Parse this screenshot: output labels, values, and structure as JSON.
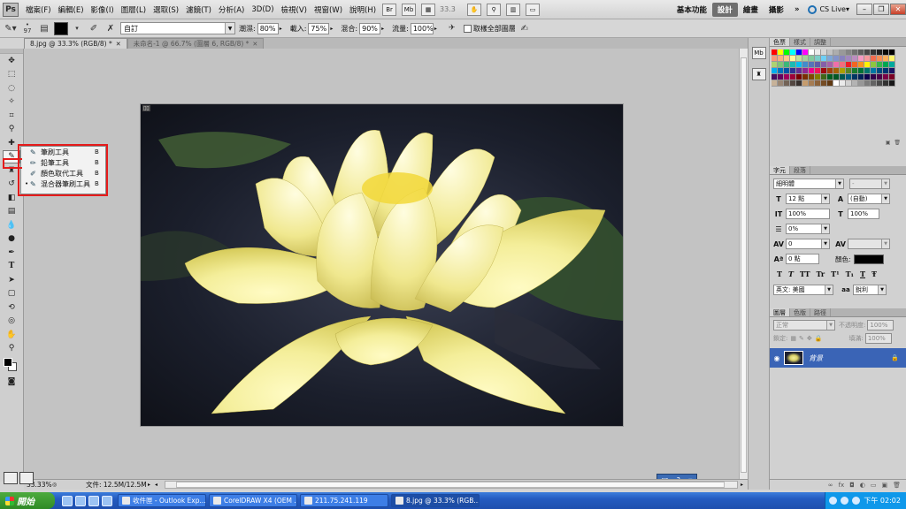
{
  "menubar": {
    "logo": "Ps",
    "menus": [
      "檔案(F)",
      "編輯(E)",
      "影像(I)",
      "圖層(L)",
      "選取(S)",
      "濾鏡(T)",
      "分析(A)",
      "3D(D)",
      "檢視(V)",
      "視窗(W)",
      "說明(H)"
    ],
    "zoom": "33.3",
    "workspaces": [
      "基本功能",
      "設計",
      "繪畫",
      "攝影"
    ],
    "active_workspace": "設計",
    "more": "»",
    "cslive": "CS Live"
  },
  "options": {
    "brush_size": "97",
    "mix_preset": "自訂",
    "wet_label": "潮濕:",
    "wet": "80%",
    "load_label": "載入:",
    "load": "75%",
    "mix_label": "混合:",
    "mix": "90%",
    "flow_label": "流量:",
    "flow": "100%",
    "sample_all": "取樣全部圖層"
  },
  "tabs": [
    {
      "label": "8.jpg @ 33.3% (RGB/8) *",
      "active": true
    },
    {
      "label": "未命名-1 @ 66.7% (圖層 6, RGB/8) *",
      "active": false
    }
  ],
  "flyout": {
    "items": [
      {
        "label": "筆刷工具",
        "key": "B",
        "selected": false
      },
      {
        "label": "鉛筆工具",
        "key": "B",
        "selected": false
      },
      {
        "label": "顏色取代工具",
        "key": "B",
        "selected": false
      },
      {
        "label": "混合器筆刷工具",
        "key": "B",
        "selected": true
      }
    ]
  },
  "status": {
    "zoom": "33.33%",
    "doc": "文件: 12.5M/12.5M"
  },
  "swatches_panel": {
    "tabs": [
      "色票",
      "樣式",
      "調整"
    ],
    "colors": [
      "#ff0000",
      "#ffff00",
      "#00ff00",
      "#00ffff",
      "#0000ff",
      "#ff00ff",
      "#ffffff",
      "#ebebeb",
      "#d6d6d6",
      "#c2c2c2",
      "#adadad",
      "#999999",
      "#858585",
      "#707070",
      "#5c5c5c",
      "#474747",
      "#333333",
      "#1f1f1f",
      "#0a0a0a",
      "#000000",
      "#f7977a",
      "#f9ad81",
      "#fdc68a",
      "#fff79a",
      "#c4df9b",
      "#a2d39c",
      "#82ca9d",
      "#7bcdc8",
      "#6ecff6",
      "#7ea7d8",
      "#8493ca",
      "#8882be",
      "#a187be",
      "#bc8dbf",
      "#f49ac2",
      "#f6989d",
      "#f26c4f",
      "#f68e55",
      "#fbaf5c",
      "#fff467",
      "#acd372",
      "#7cc576",
      "#3bb878",
      "#1abbb4",
      "#00bff3",
      "#438ccb",
      "#5574b9",
      "#605ca8",
      "#855fa8",
      "#a763a8",
      "#f06eaa",
      "#f26d7d",
      "#ed1c24",
      "#f26522",
      "#f7941d",
      "#fff200",
      "#8dc73f",
      "#39b54a",
      "#00a651",
      "#00a99d",
      "#00aeef",
      "#0072bc",
      "#0054a6",
      "#2e3192",
      "#662d91",
      "#92278f",
      "#ec008c",
      "#ed145b",
      "#9e0b0f",
      "#a0410d",
      "#a36209",
      "#aba000",
      "#598527",
      "#197b30",
      "#007236",
      "#00746b",
      "#0076a3",
      "#004b80",
      "#003471",
      "#1b1464",
      "#440e62",
      "#630460",
      "#9e005d",
      "#9e0039",
      "#790000",
      "#7b2e00",
      "#7d4900",
      "#827b00",
      "#406618",
      "#005e20",
      "#005826",
      "#005952",
      "#005b7f",
      "#003663",
      "#002157",
      "#0d004c",
      "#32004b",
      "#4b0049",
      "#7b0046",
      "#7a0026",
      "#c7b299",
      "#998675",
      "#736357",
      "#534741",
      "#37302d",
      "#c69c6d",
      "#a67c52",
      "#8c6239",
      "#754c24",
      "#603913",
      "#ffffff",
      "#eaeaea",
      "#d0d0d0",
      "#b3b3b3",
      "#979797",
      "#7c7c7c",
      "#636363",
      "#4a4a4a",
      "#313131",
      "#181818"
    ]
  },
  "character_panel": {
    "tabs": [
      "字元",
      "段落"
    ],
    "font_family": "細明體",
    "font_style": "-",
    "size": "12 點",
    "leading": "(自動)",
    "vscale": "100%",
    "hscale": "100%",
    "tsume": "0%",
    "tracking": "0",
    "kerning": "",
    "baseline": "0 點",
    "color_label": "顏色:",
    "format_buttons": [
      "T",
      "T",
      "TT",
      "Tr",
      "T¹",
      "T₁",
      "T",
      "Ŧ"
    ],
    "language": "英文: 美國",
    "aa_label": "aa",
    "antialias": "銳利"
  },
  "layers_panel": {
    "tabs": [
      "圖層",
      "色版",
      "路徑"
    ],
    "blend": "正常",
    "opacity_label": "不透明度:",
    "opacity": "100%",
    "lock_label": "鎖定:",
    "fill_label": "填滿:",
    "fill": "100%",
    "layer_name": "背景"
  },
  "taskbar": {
    "start": "開始",
    "tasks": [
      {
        "label": "收件匣 - Outlook Exp...",
        "active": false
      },
      {
        "label": "CorelDRAW X4 (OEM ...",
        "active": false
      },
      {
        "label": "211.75.241.119",
        "active": false
      },
      {
        "label": "8.jpg @ 33.3% (RGB...",
        "active": true
      }
    ],
    "clock": "下午 02:02"
  }
}
